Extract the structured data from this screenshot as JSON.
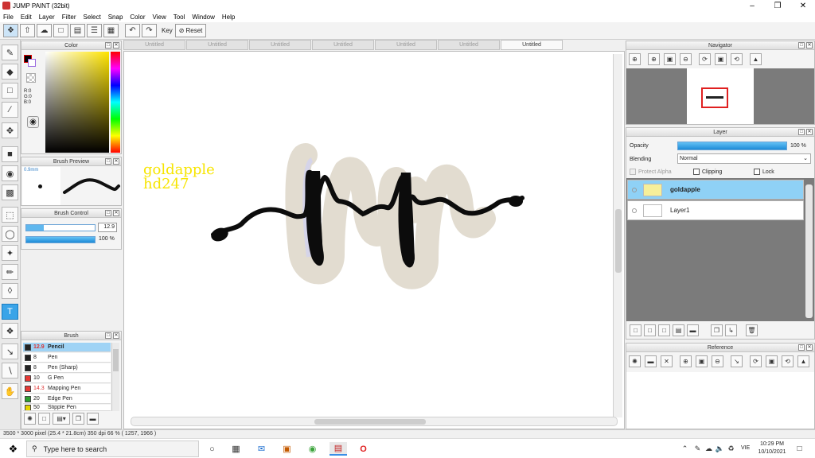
{
  "window": {
    "title": "JUMP PAINT (32bit)"
  },
  "menu": [
    "File",
    "Edit",
    "Layer",
    "Filter",
    "Select",
    "Snap",
    "Color",
    "View",
    "Tool",
    "Window",
    "Help"
  ],
  "toolbar": {
    "key_label": "Key",
    "reset_label": "Reset"
  },
  "tabs": [
    "Untitled",
    "Untitled",
    "Untitled",
    "Untitled",
    "Untitled",
    "Untitled",
    "Untitled"
  ],
  "color_panel": {
    "title": "Color",
    "r": "R:0",
    "g": "G:0",
    "b": "B:0",
    "accent": "#ff0000"
  },
  "brush_preview": {
    "title": "Brush Preview",
    "size": "0.9mm"
  },
  "brush_control": {
    "title": "Brush Control",
    "size_value": "12.9",
    "opacity_value": "100 %"
  },
  "brush_panel": {
    "title": "Brush",
    "items": [
      {
        "size": "12.9",
        "name": "Pencil",
        "color": "#222222"
      },
      {
        "size": "8",
        "name": "Pen",
        "color": "#222222"
      },
      {
        "size": "8",
        "name": "Pen (Sharp)",
        "color": "#222222"
      },
      {
        "size": "10",
        "name": "G Pen",
        "color": "#e53935"
      },
      {
        "size": "14.3",
        "name": "Mapping Pen",
        "color": "#e53935"
      },
      {
        "size": "20",
        "name": "Edge Pen",
        "color": "#2e9d2e"
      },
      {
        "size": "50",
        "name": "Stipple Pen",
        "color": "#e5d400"
      }
    ]
  },
  "canvas": {
    "watermark_line1": "goldapple",
    "watermark_line2": "hd247"
  },
  "navigator": {
    "title": "Navigator"
  },
  "layer_panel": {
    "title": "Layer",
    "opacity_label": "Opacity",
    "opacity_value": "100 %",
    "blending_label": "Blending",
    "blending_value": "Normal",
    "protect_alpha": "Protect Alpha",
    "clipping": "Clipping",
    "lock": "Lock",
    "layers": [
      "goldapple",
      "Layer1"
    ]
  },
  "reference": {
    "title": "Reference"
  },
  "status": {
    "text": "3500 * 3000 pixel   (25.4 * 21.8cm)   350 dpi   66 %   ( 1257, 1966 )"
  },
  "taskbar": {
    "search_placeholder": "Type here to search",
    "lang": "VIE",
    "time": "10:29 PM",
    "date": "10/10/2021"
  }
}
